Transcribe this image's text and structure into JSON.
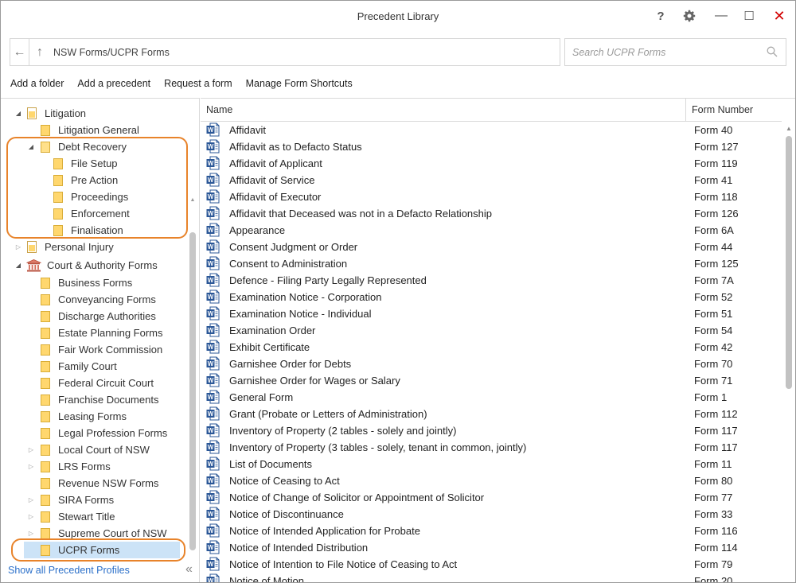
{
  "window": {
    "title": "Precedent Library",
    "help_label": "?",
    "settings_icon": "gear-icon",
    "minimize_label": "—",
    "maximize_label": "☐",
    "close_label": "✕"
  },
  "address": {
    "back_label": "←",
    "up_label": "↑",
    "path": "NSW Forms/UCPR Forms"
  },
  "search": {
    "placeholder": "Search UCPR Forms"
  },
  "toolbar": {
    "add_folder": "Add a folder",
    "add_precedent": "Add a precedent",
    "request_form": "Request a form",
    "manage_shortcuts": "Manage Form Shortcuts"
  },
  "tree": {
    "litigation": "Litigation",
    "litigation_general": "Litigation General",
    "debt_recovery": "Debt Recovery",
    "file_setup": "File Setup",
    "pre_action": "Pre Action",
    "proceedings": "Proceedings",
    "enforcement": "Enforcement",
    "finalisation": "Finalisation",
    "personal_injury": "Personal Injury",
    "court_authority": "Court & Authority Forms",
    "business_forms": "Business Forms",
    "conveyancing_forms": "Conveyancing Forms",
    "discharge_authorities": "Discharge Authorities",
    "estate_planning": "Estate Planning Forms",
    "fair_work": "Fair Work Commission",
    "family_court": "Family Court",
    "federal_circuit": "Federal Circuit Court",
    "franchise_documents": "Franchise Documents",
    "leasing_forms": "Leasing Forms",
    "legal_profession": "Legal Profession Forms",
    "local_court": "Local Court of NSW",
    "lrs_forms": "LRS Forms",
    "revenue_nsw": "Revenue NSW Forms",
    "sira_forms": "SIRA Forms",
    "stewart_title": "Stewart Title",
    "supreme_court": "Supreme Court of NSW",
    "ucpr_forms": "UCPR Forms",
    "show_all": "Show all Precedent Profiles",
    "collapse_label": "«"
  },
  "list": {
    "col_name": "Name",
    "col_form": "Form Number",
    "rows": [
      {
        "name": "Affidavit",
        "form": "Form 40"
      },
      {
        "name": "Affidavit as to Defacto Status",
        "form": "Form 127"
      },
      {
        "name": "Affidavit of Applicant",
        "form": "Form 119"
      },
      {
        "name": "Affidavit of Service",
        "form": "Form 41"
      },
      {
        "name": "Affidavit of Executor",
        "form": "Form 118"
      },
      {
        "name": "Affidavit that Deceased was not in a Defacto Relationship",
        "form": "Form 126"
      },
      {
        "name": "Appearance",
        "form": "Form 6A"
      },
      {
        "name": "Consent Judgment or Order",
        "form": "Form 44"
      },
      {
        "name": "Consent to Administration",
        "form": "Form 125"
      },
      {
        "name": "Defence - Filing Party Legally Represented",
        "form": "Form 7A"
      },
      {
        "name": "Examination Notice - Corporation",
        "form": "Form 52"
      },
      {
        "name": "Examination Notice - Individual",
        "form": "Form 51"
      },
      {
        "name": "Examination Order",
        "form": "Form 54"
      },
      {
        "name": "Exhibit Certificate",
        "form": "Form 42"
      },
      {
        "name": "Garnishee Order for Debts",
        "form": "Form 70"
      },
      {
        "name": "Garnishee Order for Wages or Salary",
        "form": "Form 71"
      },
      {
        "name": "General Form",
        "form": "Form 1"
      },
      {
        "name": "Grant (Probate or Letters of Administration)",
        "form": "Form 112"
      },
      {
        "name": "Inventory of Property (2 tables - solely and jointly)",
        "form": "Form 117"
      },
      {
        "name": "Inventory of Property (3 tables - solely, tenant in common, jointly)",
        "form": "Form 117"
      },
      {
        "name": "List of Documents",
        "form": "Form 11"
      },
      {
        "name": "Notice of Ceasing to Act",
        "form": "Form 80"
      },
      {
        "name": "Notice of Change of Solicitor or Appointment of Solicitor",
        "form": "Form 77"
      },
      {
        "name": "Notice of Discontinuance",
        "form": "Form 33"
      },
      {
        "name": "Notice of Intended Application for Probate",
        "form": "Form 116"
      },
      {
        "name": "Notice of Intended Distribution",
        "form": "Form 114"
      },
      {
        "name": "Notice of Intention to File Notice of Ceasing to Act",
        "form": "Form 79"
      },
      {
        "name": "Notice of Motion",
        "form": "Form 20"
      }
    ]
  },
  "colors": {
    "highlight": "#e8832a",
    "selected": "#cce3f7",
    "link": "#2a6fc9"
  }
}
